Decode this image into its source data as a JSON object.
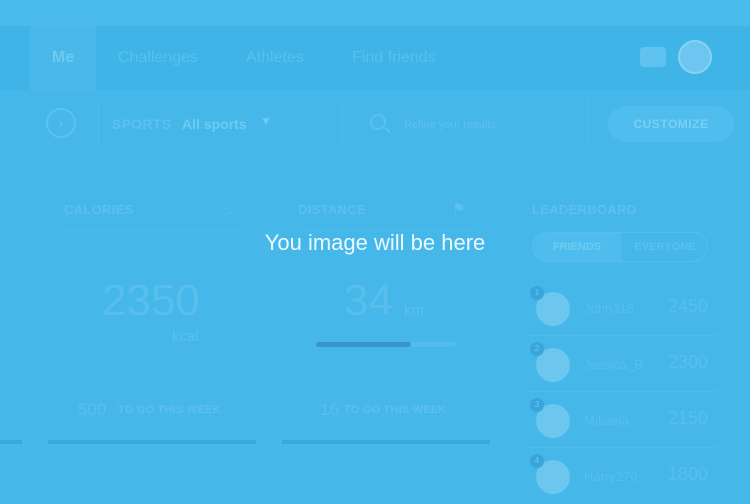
{
  "nav": {
    "tabs": [
      "Me",
      "Challenges",
      "Athletes",
      "Find friends"
    ],
    "active_tab": "Me"
  },
  "filters": {
    "sports_label": "SPORTS",
    "sports_value": "All sports",
    "search_placeholder": "Refine your results",
    "cta_label": "CUSTOMIZE"
  },
  "cards": {
    "calories": {
      "title": "CALORIES",
      "value": "2350",
      "unit": "kcal",
      "goal_value": "500",
      "goal_text": "TO GO THIS WEEK",
      "icon": "flame-icon"
    },
    "distance": {
      "title": "DISTANCE",
      "value": "34",
      "unit": "km",
      "goal_value": "16",
      "goal_text": "TO GO THIS WEEK",
      "progress": 0.68,
      "icon": "map-icon"
    }
  },
  "leaderboard": {
    "title": "LEADERBOARD",
    "toggle": [
      "FRIENDS",
      "EVERYONE"
    ],
    "rows": [
      {
        "rank": "1",
        "name": "John318",
        "score": "2450"
      },
      {
        "rank": "2",
        "name": "Jessica_B",
        "score": "2300"
      },
      {
        "rank": "3",
        "name": "Mikaela",
        "score": "2150"
      },
      {
        "rank": "4",
        "name": "Harry270",
        "score": "1800"
      }
    ]
  },
  "overlay": {
    "text": "You image will be here"
  }
}
